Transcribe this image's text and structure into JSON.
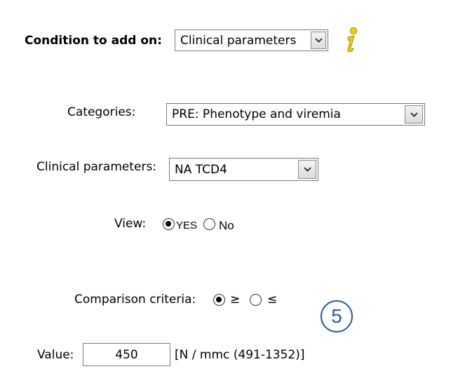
{
  "condition": {
    "label": "Condition to add on:",
    "select_value": "Clinical parameters",
    "info_icon": "info-icon",
    "info_color": "#f2d400"
  },
  "categories": {
    "label": "Categories:",
    "select_value": "PRE: Phenotype and viremia"
  },
  "clinical_parameters": {
    "label": "Clinical parameters:",
    "select_value": "NA TCD4"
  },
  "view": {
    "label": "View:",
    "options": [
      {
        "label": "YES",
        "selected": true
      },
      {
        "label": "No",
        "selected": false
      }
    ]
  },
  "comparison": {
    "label": "Comparison criteria:",
    "options": [
      {
        "label": "≥",
        "selected": true
      },
      {
        "label": "≤",
        "selected": false
      }
    ]
  },
  "step_badge": {
    "number": "5",
    "color": "#2e5b8f"
  },
  "value": {
    "label": "Value:",
    "input_value": "450",
    "unit": "[N / mmc (491-1352)]"
  }
}
